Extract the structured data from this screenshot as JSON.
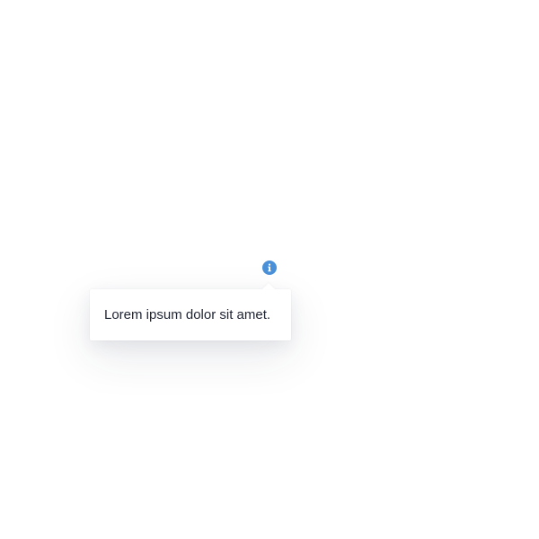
{
  "info_button": {
    "icon": "info-icon",
    "color": "#4a90d9"
  },
  "tooltip": {
    "text": "Lorem ipsum dolor sit amet."
  }
}
